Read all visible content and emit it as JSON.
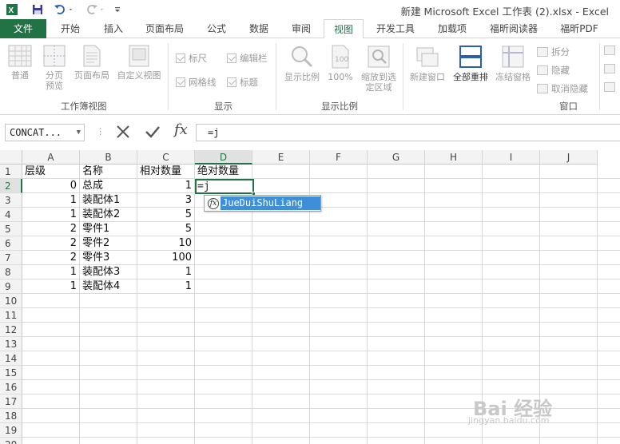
{
  "app": {
    "title": "新建 Microsoft Excel 工作表 (2).xlsx - Excel"
  },
  "tabs": [
    "文件",
    "开始",
    "插入",
    "页面布局",
    "公式",
    "数据",
    "审阅",
    "视图",
    "开发工具",
    "加载项",
    "福昕阅读器",
    "福昕PDF"
  ],
  "active_tab": "视图",
  "ribbon": {
    "workbook_views": {
      "label": "工作簿视图",
      "buttons": [
        "普通",
        "分页预览",
        "页面布局",
        "自定义视图"
      ]
    },
    "show": {
      "label": "显示",
      "checkboxes": [
        "标尺",
        "编辑栏",
        "网格线",
        "标题"
      ]
    },
    "zoom": {
      "label": "显示比例",
      "buttons": [
        "显示比例",
        "100%",
        "缩放到选定区域"
      ]
    },
    "window": {
      "label": "窗口",
      "buttons": [
        "新建窗口",
        "全部重排",
        "冻结窗格"
      ],
      "small": [
        "拆分",
        "隐藏",
        "取消隐藏"
      ]
    }
  },
  "formula_bar": {
    "name_box": "CONCAT...",
    "formula": "=j"
  },
  "columns": [
    "A",
    "B",
    "C",
    "D",
    "E",
    "F",
    "G",
    "H",
    "I",
    "J"
  ],
  "selected_column": "D",
  "selected_row": "2",
  "rows": [
    {
      "n": "1",
      "a": "层级",
      "b": "名称",
      "c": "相对数量",
      "d": "绝对数量"
    },
    {
      "n": "2",
      "a": "0",
      "b": "总成",
      "c": "1",
      "d": ""
    },
    {
      "n": "3",
      "a": "1",
      "b": "装配体1",
      "c": "3",
      "d": ""
    },
    {
      "n": "4",
      "a": "1",
      "b": "装配体2",
      "c": "5",
      "d": ""
    },
    {
      "n": "5",
      "a": "2",
      "b": "零件1",
      "c": "5",
      "d": ""
    },
    {
      "n": "6",
      "a": "2",
      "b": "零件2",
      "c": "10",
      "d": ""
    },
    {
      "n": "7",
      "a": "2",
      "b": "零件3",
      "c": "100",
      "d": ""
    },
    {
      "n": "8",
      "a": "1",
      "b": "装配体3",
      "c": "1",
      "d": ""
    },
    {
      "n": "9",
      "a": "1",
      "b": "装配体4",
      "c": "1",
      "d": ""
    },
    {
      "n": "10"
    },
    {
      "n": "11"
    },
    {
      "n": "12"
    },
    {
      "n": "13"
    },
    {
      "n": "14"
    },
    {
      "n": "15"
    },
    {
      "n": "16"
    },
    {
      "n": "17"
    },
    {
      "n": "18"
    },
    {
      "n": "19"
    },
    {
      "n": "20"
    }
  ],
  "active_cell_text": "=j",
  "autocomplete": {
    "item": "JueDuiShuLiang",
    "icon": "fx"
  },
  "watermark": {
    "text": "Bai 经验",
    "sub": "jingyan.baidu.com"
  },
  "colors": {
    "accent": "#217346",
    "autocomplete_highlight": "#3e8ed8"
  }
}
